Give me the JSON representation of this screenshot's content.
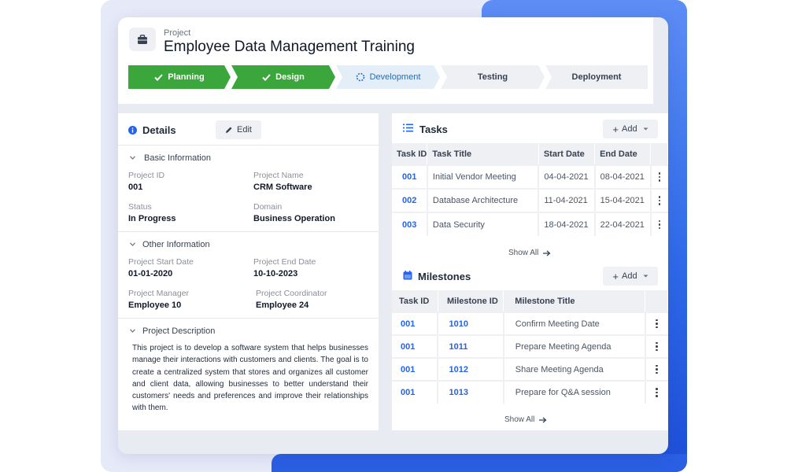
{
  "project": {
    "small_label": "Project",
    "title": "Employee Data Management Training",
    "icon": "briefcase-icon"
  },
  "stages": [
    {
      "label": "Planning",
      "state": "done"
    },
    {
      "label": "Design",
      "state": "done"
    },
    {
      "label": "Development",
      "state": "active"
    },
    {
      "label": "Testing",
      "state": "todo"
    },
    {
      "label": "Deployment",
      "state": "todo"
    }
  ],
  "details": {
    "title": "Details",
    "edit_label": "Edit",
    "basic": {
      "title": "Basic Information",
      "project_id_label": "Project ID",
      "project_id": "001",
      "project_name_label": "Project Name",
      "project_name": "CRM Software",
      "status_label": "Status",
      "status": "In Progress",
      "domain_label": "Domain",
      "domain": "Business Operation"
    },
    "other": {
      "title": "Other Information",
      "start_label": "Project Start Date",
      "start": "01-01-2020",
      "end_label": "Project End Date",
      "end": "10-10-2023",
      "manager_label": "Project Manager",
      "manager": "Employee 10",
      "coordinator_label": "Project Coordinator",
      "coordinator": "Employee 24"
    },
    "description": {
      "title": "Project Description",
      "text": "This project is to develop a software system that helps businesses manage their interactions with customers and clients. The goal is to create a centralized system that stores and organizes all customer and client data, allowing businesses to better understand their customers' needs and preferences and improve their relationships with them."
    }
  },
  "tasks": {
    "title": "Tasks",
    "add_label": "Add",
    "columns": [
      "Task ID",
      "Task Title",
      "Start Date",
      "End Date"
    ],
    "rows": [
      {
        "id": "001",
        "title": "Initial Vendor Meeting",
        "start": "04-04-2021",
        "end": "08-04-2021"
      },
      {
        "id": "002",
        "title": "Database Architecture",
        "start": "11-04-2021",
        "end": "15-04-2021"
      },
      {
        "id": "003",
        "title": "Data Security",
        "start": "18-04-2021",
        "end": "22-04-2021"
      }
    ],
    "show_all": "Show All"
  },
  "milestones": {
    "title": "Milestones",
    "add_label": "Add",
    "columns": [
      "Task ID",
      "Milestone ID",
      "Milestone Title"
    ],
    "rows": [
      {
        "task": "001",
        "id": "1010",
        "title": "Confirm Meeting Date"
      },
      {
        "task": "001",
        "id": "1011",
        "title": "Prepare Meeting Agenda"
      },
      {
        "task": "001",
        "id": "1012",
        "title": "Share Meeting Agenda"
      },
      {
        "task": "001",
        "id": "1013",
        "title": "Prepare for Q&A session"
      }
    ],
    "show_all": "Show All"
  },
  "colors": {
    "done": "#3aa63c",
    "active_text": "#2b6cb0",
    "accent_blue": "#2563eb"
  }
}
